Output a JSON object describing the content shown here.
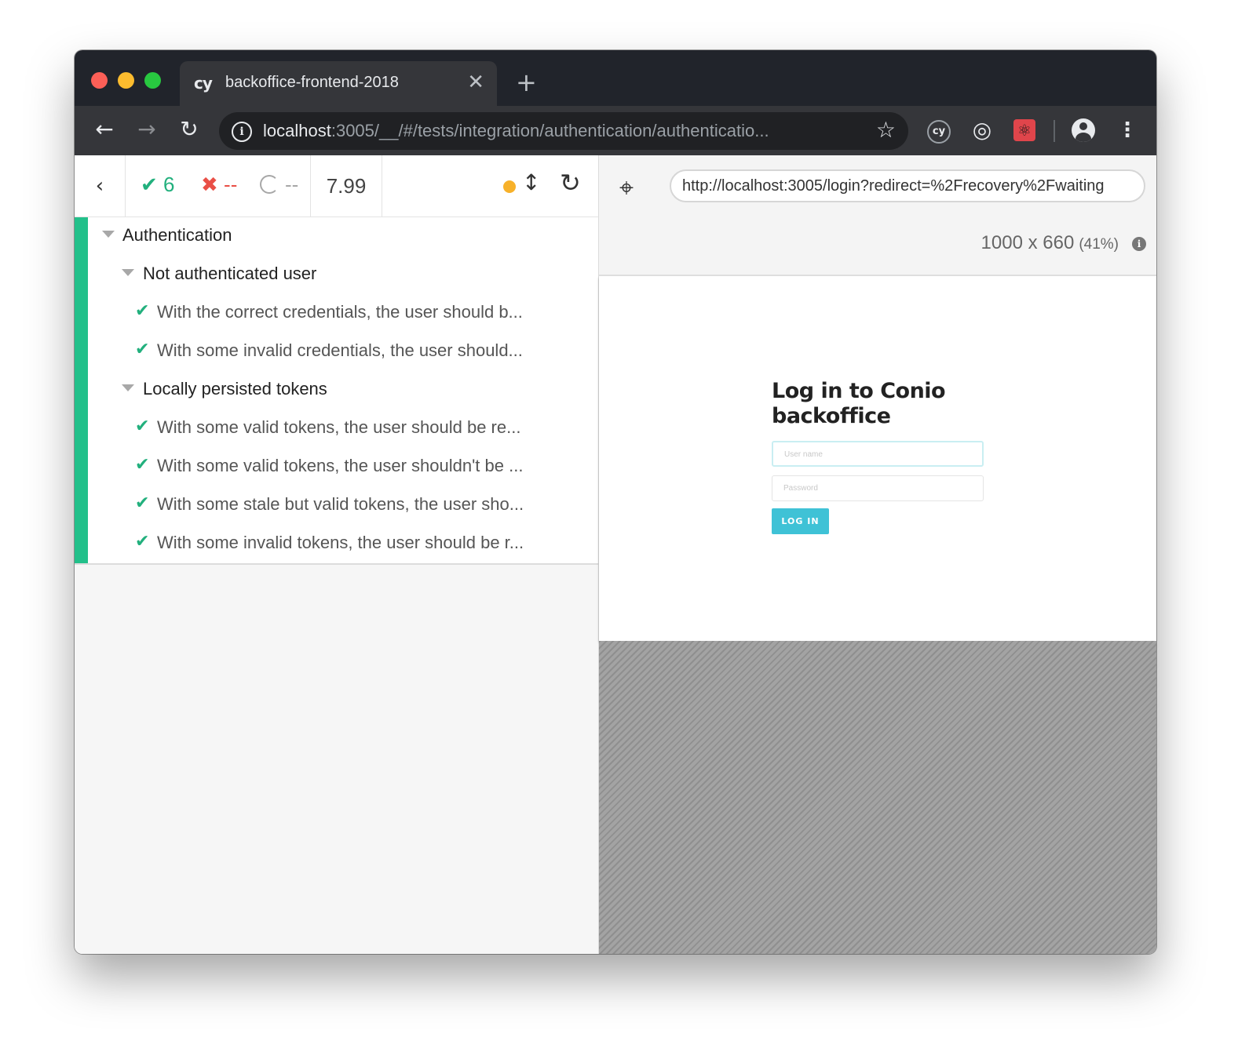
{
  "browser": {
    "tab": {
      "favicon": "cy",
      "title": "backoffice-frontend-2018",
      "close_icon": "✕"
    },
    "new_tab_icon": "+",
    "nav": {
      "back_icon": "←",
      "forward_icon": "→",
      "reload_icon": "↻"
    },
    "omnibox": {
      "info_icon": "i",
      "url_host": "localhost",
      "url_rest": ":3005/__/#/tests/integration/authentication/authenticatio...",
      "star_icon": "☆"
    },
    "extensions": {
      "cypress_label": "cy",
      "target_icon": "◎",
      "react_icon": "⚛",
      "menu_icon": "⋮"
    }
  },
  "reporter": {
    "header": {
      "back_icon": "‹",
      "passed_icon": "✔",
      "passed_count": "6",
      "failed_icon": "✖",
      "failed_count": "--",
      "pending_count": "--",
      "duration": "7.99",
      "scroll_icon": "↕",
      "restart_icon": "↻",
      "status_color": "#f7b12a"
    },
    "suite": {
      "title": "Authentication",
      "groups": [
        {
          "title": "Not authenticated user",
          "tests": [
            "With the correct credentials, the user should b...",
            "With some invalid credentials, the user should..."
          ]
        },
        {
          "title": "Locally persisted tokens",
          "tests": [
            "With some valid tokens, the user should be re...",
            "With some valid tokens, the user shouldn't be ...",
            "With some stale but valid tokens, the user sho...",
            "With some invalid tokens, the user should be r..."
          ]
        }
      ]
    },
    "check_icon": "✔",
    "pass_color": "#22c08a"
  },
  "preview": {
    "selector_icon": "⌖",
    "url": "http://localhost:3005/login?redirect=%2Frecovery%2Fwaiting",
    "viewport": "1000 x 660",
    "scale": "(41%)",
    "info_icon": "i",
    "app": {
      "title": "Log in to Conio backoffice",
      "username_placeholder": "User name",
      "password_placeholder": "Password",
      "login_label": "LOG IN",
      "accent_color": "#3fc2d6"
    }
  }
}
